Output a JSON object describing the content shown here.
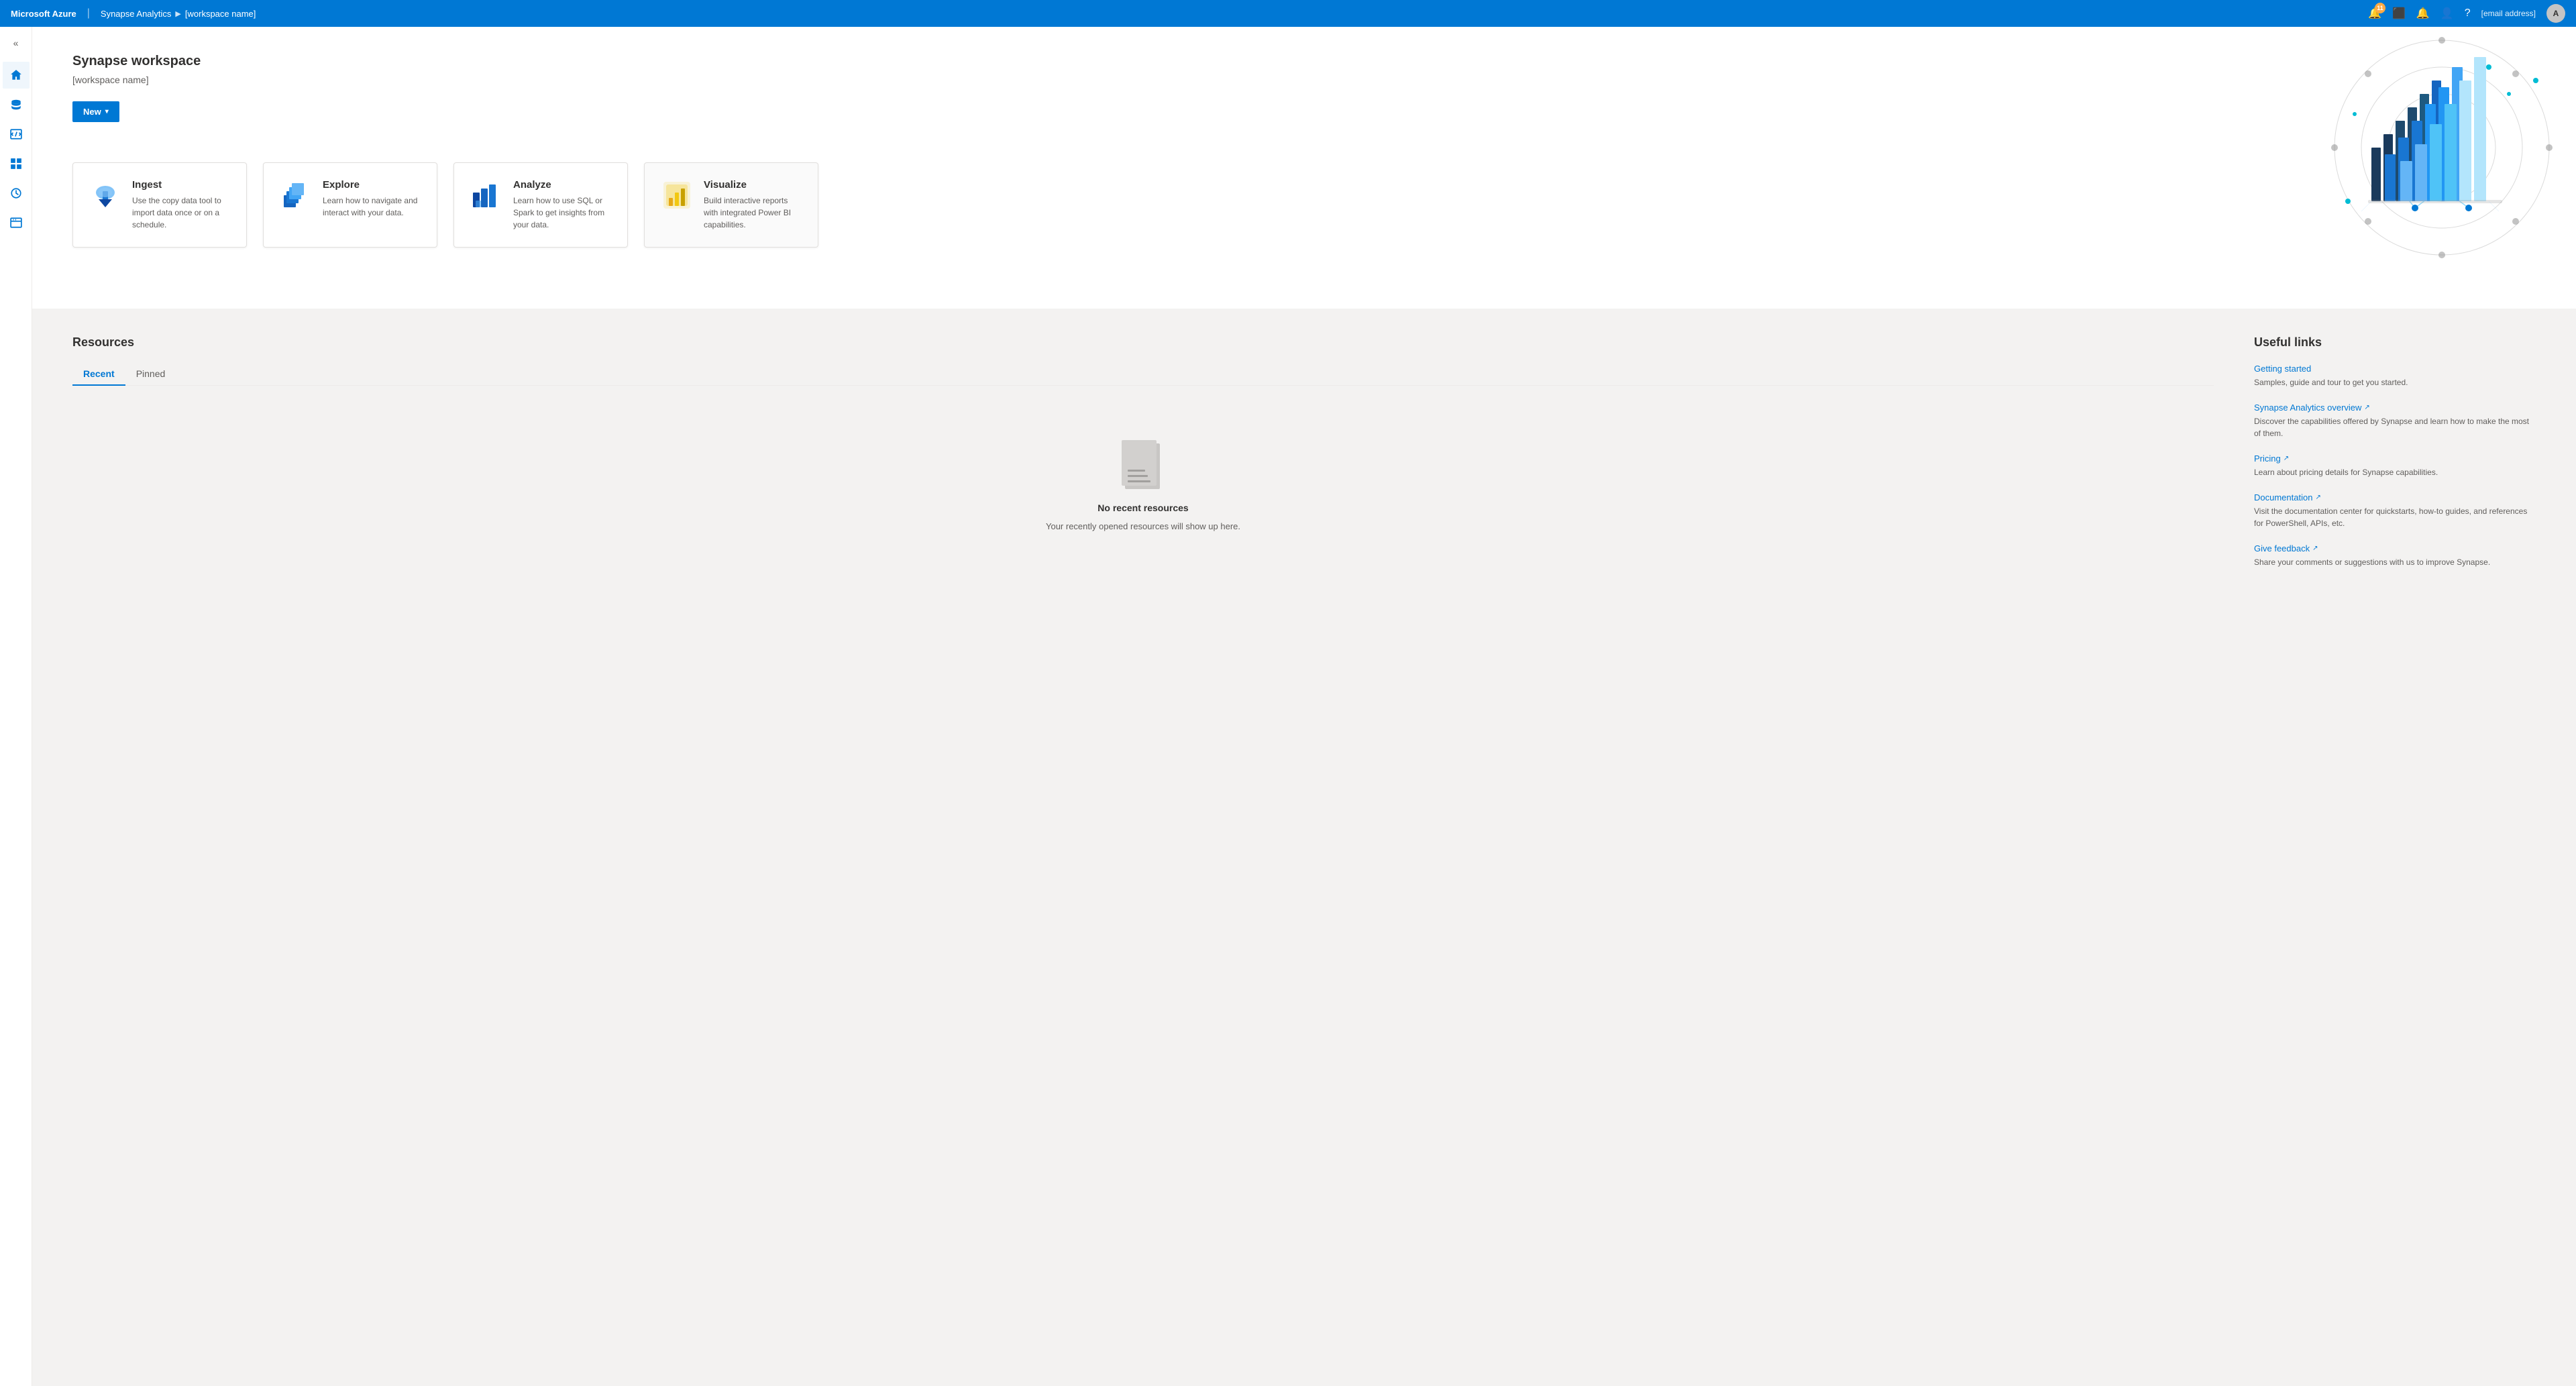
{
  "topnav": {
    "brand": "Microsoft Azure",
    "separator": "|",
    "product": "Synapse Analytics",
    "arrow": "▶",
    "workspace_nav": "[workspace name]",
    "notification_count": "11",
    "email": "[email address]"
  },
  "sidebar": {
    "toggle_label": "«",
    "items": [
      {
        "id": "home",
        "icon": "home",
        "label": "Home"
      },
      {
        "id": "data",
        "icon": "database",
        "label": "Data"
      },
      {
        "id": "develop",
        "icon": "code",
        "label": "Develop"
      },
      {
        "id": "integrate",
        "icon": "integrate",
        "label": "Integrate"
      },
      {
        "id": "monitor",
        "icon": "monitor",
        "label": "Monitor"
      },
      {
        "id": "manage",
        "icon": "manage",
        "label": "Manage"
      }
    ]
  },
  "hero": {
    "title": "Synapse workspace",
    "subtitle": "[workspace name]",
    "new_button": "New",
    "new_button_chevron": "▾"
  },
  "feature_cards": [
    {
      "id": "ingest",
      "title": "Ingest",
      "description": "Use the copy data tool to import data once or on a schedule."
    },
    {
      "id": "explore",
      "title": "Explore",
      "description": "Learn how to navigate and interact with your data."
    },
    {
      "id": "analyze",
      "title": "Analyze",
      "description": "Learn how to use SQL or Spark to get insights from your data."
    },
    {
      "id": "visualize",
      "title": "Visualize",
      "description": "Build interactive reports with integrated Power BI capabilities."
    }
  ],
  "resources": {
    "section_title": "Resources",
    "tabs": [
      {
        "id": "recent",
        "label": "Recent",
        "active": true
      },
      {
        "id": "pinned",
        "label": "Pinned",
        "active": false
      }
    ],
    "empty_title": "No recent resources",
    "empty_desc": "Your recently opened resources will show up here."
  },
  "useful_links": {
    "section_title": "Useful links",
    "links": [
      {
        "id": "getting-started",
        "title": "Getting started",
        "description": "Samples, guide and tour to get you started.",
        "external": false
      },
      {
        "id": "synapse-overview",
        "title": "Synapse Analytics overview",
        "description": "Discover the capabilities offered by Synapse and learn how to make the most of them.",
        "external": true
      },
      {
        "id": "pricing",
        "title": "Pricing",
        "description": "Learn about pricing details for Synapse capabilities.",
        "external": true
      },
      {
        "id": "documentation",
        "title": "Documentation",
        "description": "Visit the documentation center for quickstarts, how-to guides, and references for PowerShell, APIs, etc.",
        "external": true
      },
      {
        "id": "give-feedback",
        "title": "Give feedback",
        "description": "Share your comments or suggestions with us to improve Synapse.",
        "external": true
      }
    ]
  }
}
